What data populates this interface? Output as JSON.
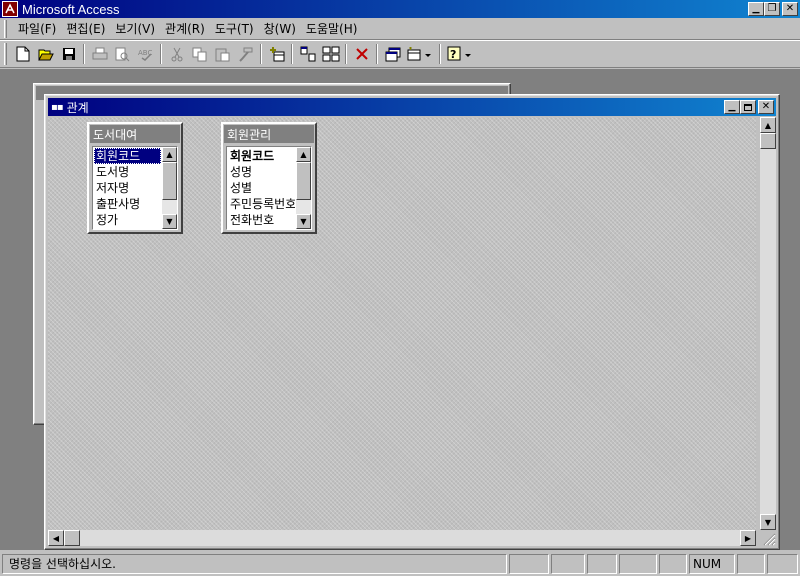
{
  "app": {
    "title": "Microsoft Access",
    "min_glyph": "▁",
    "restore_glyph": "❐",
    "close_glyph": "✕"
  },
  "menu": {
    "items": [
      "파일(F)",
      "편집(E)",
      "보기(V)",
      "관계(R)",
      "도구(T)",
      "창(W)",
      "도움말(H)"
    ]
  },
  "toolbar": {
    "icons": [
      "new-icon",
      "open-icon",
      "save-icon",
      "print-icon",
      "print-preview-icon",
      "spelling-icon",
      "cut-icon",
      "copy-icon",
      "paste-icon",
      "format-painter-icon",
      "show-table-icon",
      "show-direct-icon",
      "show-all-icon",
      "delete-icon",
      "database-window-icon",
      "new-object-icon",
      "help-icon"
    ]
  },
  "relationship_window": {
    "title": "관계",
    "tables": [
      {
        "name": "도서대여",
        "fields": [
          "회원코드",
          "도서명",
          "저자명",
          "출판사명",
          "정가"
        ],
        "selected_field": "회원코드"
      },
      {
        "name": "회원관리",
        "fields": [
          "회원코드",
          "성명",
          "성별",
          "주민등록번호",
          "전화번호"
        ],
        "key_field": "회원코드"
      }
    ]
  },
  "status": {
    "message": "명령을 선택하십시오.",
    "num_indicator": "NUM"
  },
  "colors": {
    "titlebar_active": "#000080",
    "titlebar_gradient_end": "#1084d0",
    "face": "#c0c0c0",
    "selection": "#000080"
  }
}
